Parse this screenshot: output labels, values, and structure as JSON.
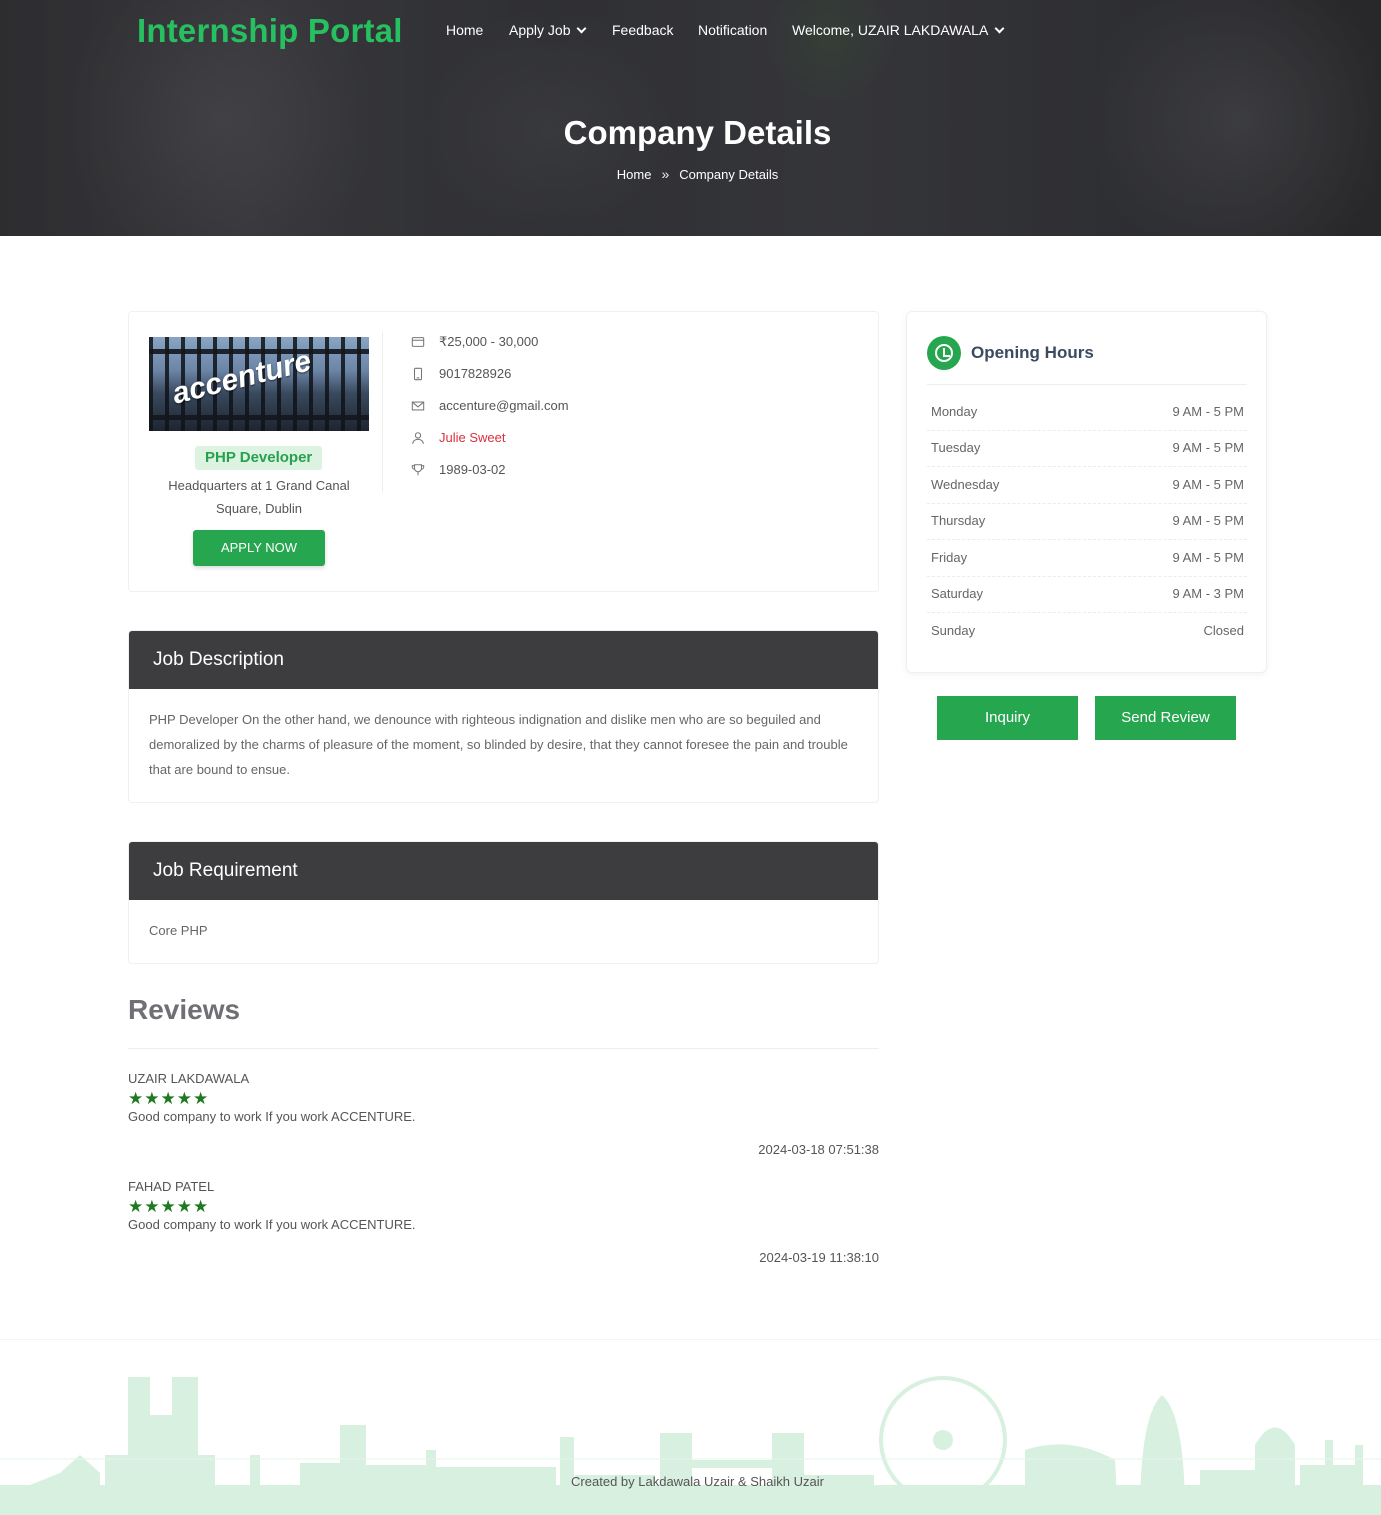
{
  "header": {
    "brand": "Internship Portal",
    "nav": [
      {
        "label": "Home"
      },
      {
        "label": "Apply Job"
      },
      {
        "label": "Feedback"
      },
      {
        "label": "Notification"
      },
      {
        "label": "Welcome, UZAIR LAKDAWALA"
      }
    ],
    "page_title": "Company Details",
    "breadcrumb": [
      "Home",
      "Company Details"
    ]
  },
  "company": {
    "logo_text": "accenture",
    "role": "PHP Developer",
    "address": "Headquarters at 1 Grand Canal Square, Dublin",
    "apply_label": "APPLY NOW",
    "salary": "₹25,000 - 30,000",
    "phone": "9017828926",
    "email": "accenture@gmail.com",
    "contact_person": "Julie Sweet",
    "date": "1989-03-02"
  },
  "job_description": {
    "title": "Job Description",
    "text": "PHP Developer On the other hand, we denounce with righteous indignation and dislike men who are so beguiled and demoralized by the charms of pleasure of the moment, so blinded by desire, that they cannot foresee the pain and trouble that are bound to ensue."
  },
  "job_requirement": {
    "title": "Job Requirement",
    "text": "Core PHP"
  },
  "reviews": {
    "title": "Reviews",
    "items": [
      {
        "name": "UZAIR LAKDAWALA",
        "rating": 5,
        "stars": "★★★★★",
        "text": "Good company to work If you work ACCENTURE.",
        "date": "2024-03-18 07:51:38"
      },
      {
        "name": "FAHAD PATEL",
        "rating": 5,
        "stars": "★★★★★",
        "text": "Good company to work If you work ACCENTURE.",
        "date": "2024-03-19 11:38:10"
      }
    ]
  },
  "opening_hours": {
    "title": "Opening Hours",
    "rows": [
      {
        "day": "Monday",
        "time": "9 AM - 5 PM"
      },
      {
        "day": "Tuesday",
        "time": "9 AM - 5 PM"
      },
      {
        "day": "Wednesday",
        "time": "9 AM - 5 PM"
      },
      {
        "day": "Thursday",
        "time": "9 AM - 5 PM"
      },
      {
        "day": "Friday",
        "time": "9 AM - 5 PM"
      },
      {
        "day": "Saturday",
        "time": "9 AM - 3 PM"
      },
      {
        "day": "Sunday",
        "time": "Closed"
      }
    ]
  },
  "actions": {
    "inquiry_label": "Inquiry",
    "review_label": "Send Review"
  },
  "footer": {
    "credit": "Created by Lakdawala Uzair & Shaikh Uzair"
  },
  "colors": {
    "brand_green": "#27c060",
    "button_green": "#27a650",
    "panel_header": "#3d3d3f",
    "star_green": "#1f7a1f",
    "contact_red": "#d9313f"
  }
}
